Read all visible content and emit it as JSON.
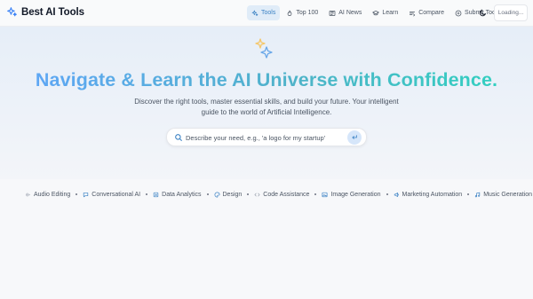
{
  "brand": {
    "name": "Best AI Tools",
    "icon": "sparkles-icon"
  },
  "nav": {
    "items": [
      {
        "label": "Tools",
        "icon": "sparkles-icon",
        "active": true
      },
      {
        "label": "Top 100",
        "icon": "flame-icon",
        "active": false
      },
      {
        "label": "AI News",
        "icon": "newspaper-icon",
        "active": false
      },
      {
        "label": "Learn",
        "icon": "graduation-cap-icon",
        "active": false
      },
      {
        "label": "Compare",
        "icon": "compare-icon",
        "active": false
      },
      {
        "label": "Submit Tool",
        "icon": "plus-circle-icon",
        "active": false
      }
    ],
    "theme_icon": "moon-icon",
    "loading_label": "Loading..."
  },
  "hero": {
    "headline": "Navigate & Learn the AI Universe with Confidence.",
    "subhead": "Discover the right tools, master essential skills, and build your future. Your intelligent guide to the world of Artificial Intelligence."
  },
  "search": {
    "placeholder": "Describe your need, e.g., 'a logo for my startup'",
    "value": ""
  },
  "categories": [
    {
      "label": "Audio Editing",
      "icon": "audio-icon"
    },
    {
      "label": "Conversational AI",
      "icon": "chat-icon"
    },
    {
      "label": "Data Analytics",
      "icon": "chart-icon"
    },
    {
      "label": "Design",
      "icon": "palette-icon"
    },
    {
      "label": "Code Assistance",
      "icon": "code-icon"
    },
    {
      "label": "Image Generation",
      "icon": "image-icon"
    },
    {
      "label": "Marketing Automation",
      "icon": "megaphone-icon"
    },
    {
      "label": "Music Generation",
      "icon": "music-icon"
    }
  ],
  "colors": {
    "accent": "#3b82c4",
    "headline_start": "#60a5fa",
    "headline_end": "#2dd4bf",
    "hero_bg": "#e6eef8"
  }
}
